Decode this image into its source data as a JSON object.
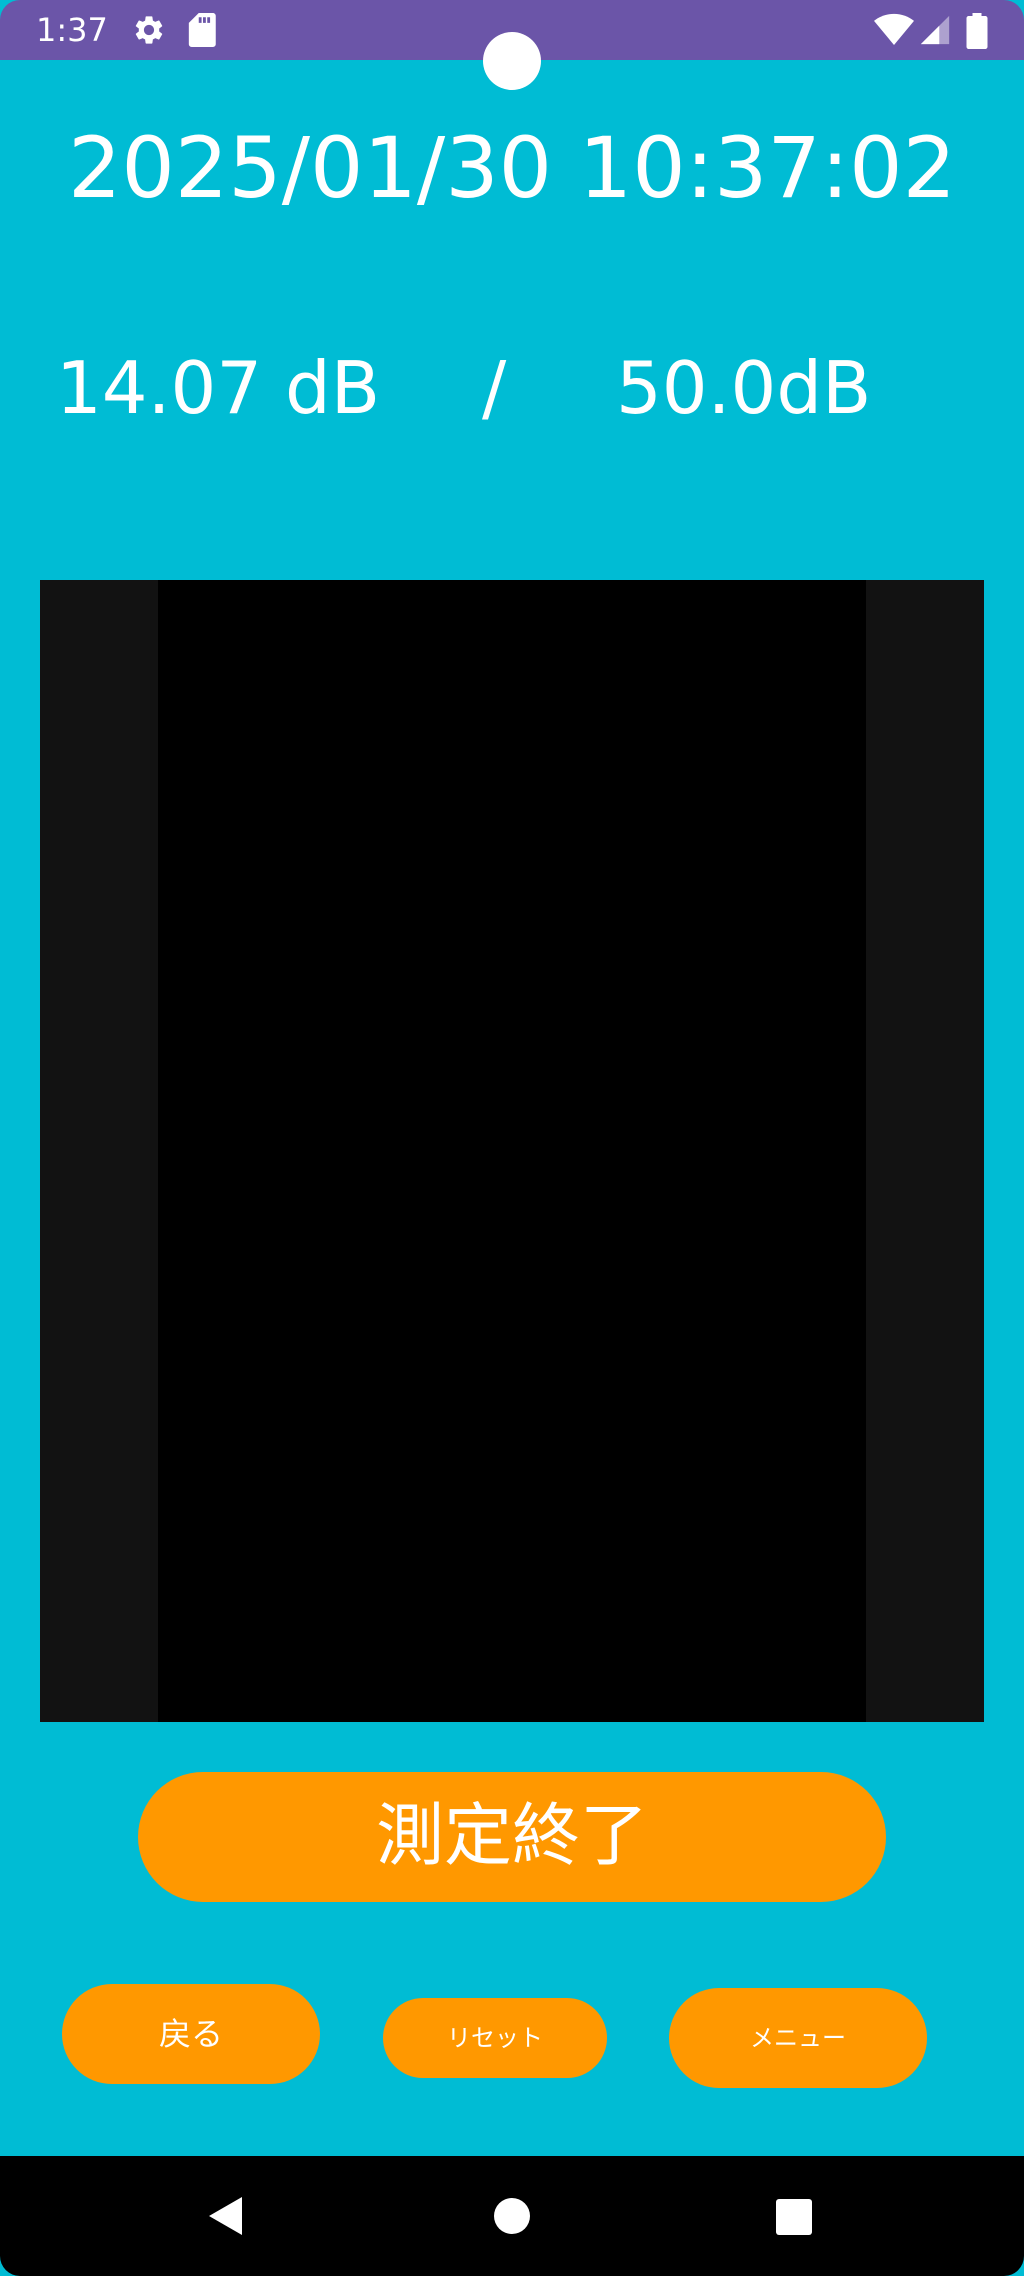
{
  "status_bar": {
    "time": "1:37",
    "icons": [
      "gear-icon",
      "sd-card-icon",
      "wifi-icon",
      "signal-icon",
      "battery-icon"
    ]
  },
  "clock": {
    "datetime": "2025/01/30 10:37:02"
  },
  "levels": {
    "current": "14.07 dB",
    "separator": "/",
    "threshold": "50.0dB"
  },
  "buttons": {
    "stop_label": "測定終了",
    "back_label": "戻る",
    "reset_label": "リセット",
    "menu_label": "メニュー"
  },
  "nav_bar": {
    "icons": [
      "back-triangle-icon",
      "home-circle-icon",
      "recents-square-icon"
    ]
  },
  "colors": {
    "background": "#00BCD4",
    "status_bar": "#6B55A8",
    "button": "#FF9800",
    "text": "#FFFFFF"
  }
}
